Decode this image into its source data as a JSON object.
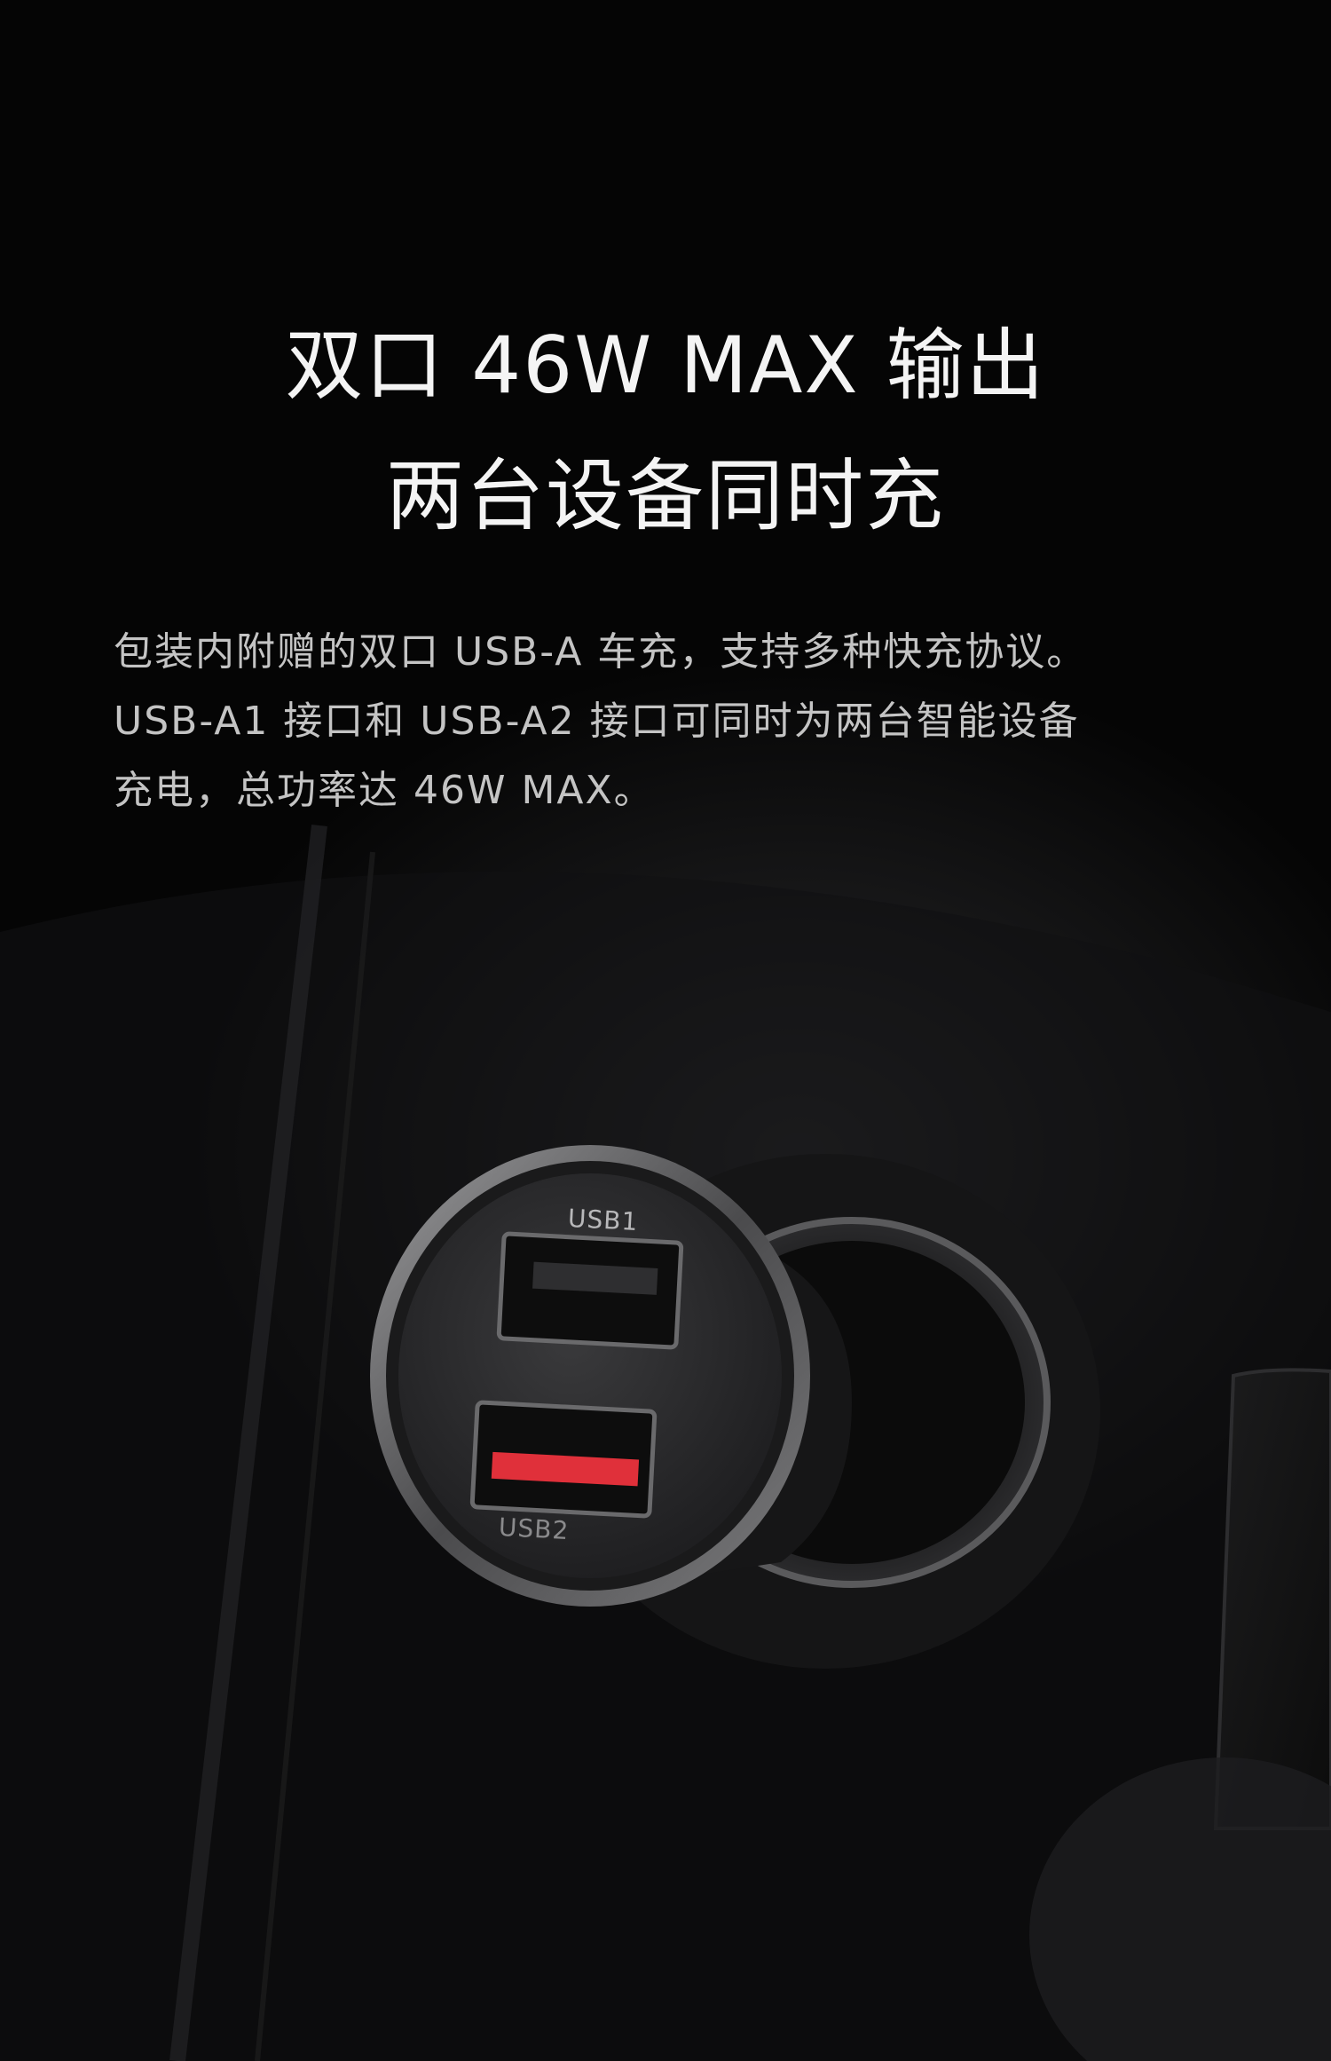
{
  "headline": {
    "line1": "双口 46W MAX 输出",
    "line2": "两台设备同时充"
  },
  "description": {
    "line1": "包装内附赠的双口 USB-A 车充，支持多种快充协议。",
    "line2": "USB-A1 接口和 USB-A2 接口可同时为两台智能设备",
    "line3": "充电，总功率达 46W MAX。"
  },
  "product": {
    "port1_label": "USB1",
    "port2_label": "USB2",
    "port2_accent": "#e0303a"
  }
}
